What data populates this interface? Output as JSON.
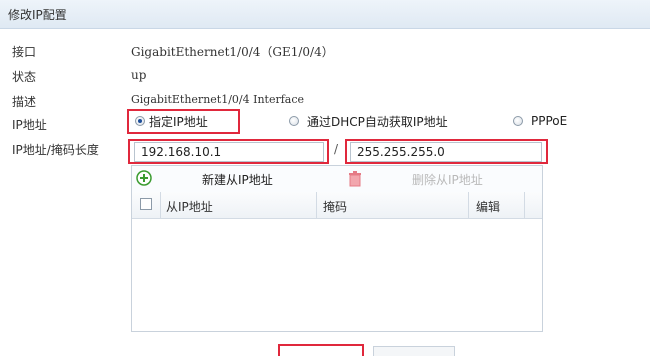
{
  "window": {
    "title": "修改IP配置"
  },
  "fields": [
    {
      "label": "接口",
      "value": "GigabitEthernet1/0/4（GE1/0/4）"
    },
    {
      "label": "状态",
      "value": "up"
    },
    {
      "label": "描述",
      "value": "GigabitEthernet1/0/4 Interface"
    }
  ],
  "ip_mode": {
    "label": "IP地址",
    "options": [
      "指定IP地址",
      "通过DHCP自动获取IP地址",
      "PPPoE"
    ],
    "selected": "指定IP地址"
  },
  "ip_mask": {
    "label": "IP地址/掩码长度",
    "ip_value": "192.168.10.1",
    "separator": "/",
    "mask_value": "255.255.255.0"
  },
  "secondary_ip": {
    "add_label": "新建从IP地址",
    "delete_label": "删除从IP地址",
    "columns": [
      "从IP地址",
      "掩码",
      "编辑"
    ],
    "rows": []
  },
  "colors": {
    "highlight": "#e0283c",
    "add_icon": "#3a9b2f",
    "delete_icon": "#e57b86"
  }
}
